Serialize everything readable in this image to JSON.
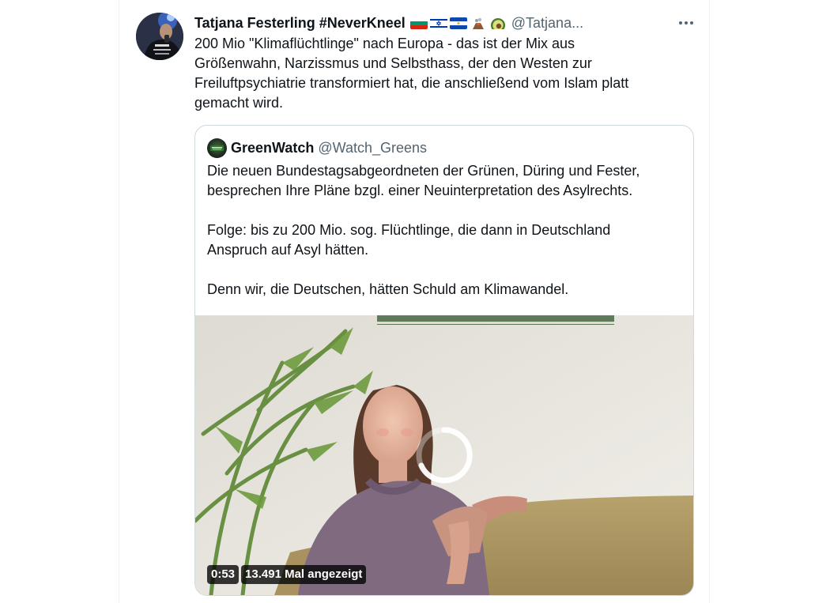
{
  "tweet": {
    "author_name": "Tatjana Festerling #NeverKneel",
    "author_handle": "@Tatjana...",
    "flag_icons": [
      "bulgaria-flag-icon",
      "israel-flag-icon",
      "el-salvador-flag-icon",
      "volcano-icon",
      "avocado-icon"
    ],
    "text": "200 Mio \"Klimaflüchtlinge\" nach Europa - das ist der Mix aus\nGrößenwahn, Narzissmus und Selbsthass, der den Westen zur\nFreiluftpsychiatrie transformiert hat, die anschließend vom Islam platt\ngemacht wird."
  },
  "quoted": {
    "author_name": "GreenWatch",
    "author_handle": "@Watch_Greens",
    "text": "Die neuen Bundestagsabgeordneten der Grünen, Düring und Fester,\nbesprechen Ihre Pläne bzgl. einer Neuinterpretation des Asylrechts.\n\nFolge: bis zu 200 Mio. sog. Flüchtlinge, die dann in Deutschland\nAnspruch auf Asyl hätten.\n\nDenn wir, die Deutschen, hätten Schuld am Klimawandel.",
    "video": {
      "duration": "0:53",
      "views": "13.491 Mal angezeigt"
    }
  },
  "colors": {
    "text": "#0f1419",
    "secondary": "#536471",
    "border": "#cfd9de"
  }
}
